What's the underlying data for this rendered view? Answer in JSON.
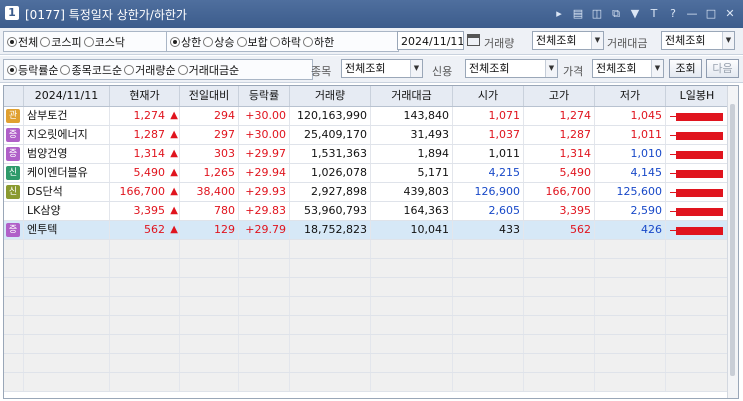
{
  "window": {
    "number": "1",
    "title": "[0177] 특정일자 상한가/하한가",
    "controls": [
      "▸",
      "▤",
      "◫",
      "⧉",
      "▼",
      "T",
      "?",
      "—",
      "□",
      "✕"
    ]
  },
  "filters1": {
    "market": [
      "전체",
      "코스피",
      "코스닥"
    ],
    "market_selected": "전체",
    "limit": [
      "상한",
      "상승",
      "보합",
      "하락",
      "하한"
    ],
    "limit_selected": "상한",
    "date": "2024/11/11",
    "volume_label": "거래량",
    "volume_value": "전체조회",
    "amount_label": "거래대금",
    "amount_value": "전체조회"
  },
  "filters2": {
    "sort": [
      "등락률순",
      "종목코드순",
      "거래량순",
      "거래대금순"
    ],
    "sort_selected": "등락률순",
    "item_label": "종목",
    "item_value": "전체조회",
    "credit_label": "신용",
    "credit_value": "전체조회",
    "price_label": "가격",
    "price_value": "전체조회",
    "search_btn": "조회",
    "next_btn": "다음"
  },
  "table": {
    "columns": [
      "2024/11/11",
      "현재가",
      "전일대비",
      "등락률",
      "거래량",
      "거래대금",
      "시가",
      "고가",
      "저가",
      "L일봉H"
    ],
    "rows": [
      {
        "badge": "관",
        "badge_color": "#e0a030",
        "name": "삼부토건",
        "price": "1,274",
        "change": "294",
        "rate": "+30.00",
        "volume": "120,163,990",
        "amount": "143,840",
        "open": "1,071",
        "open_dir": "up",
        "high": "1,274",
        "high_dir": "up",
        "low": "1,045",
        "low_dir": "up",
        "bar": 0.95
      },
      {
        "badge": "증",
        "badge_color": "#b060c8",
        "name": "지오릿에너지",
        "price": "1,287",
        "change": "297",
        "rate": "+30.00",
        "volume": "25,409,170",
        "amount": "31,493",
        "open": "1,037",
        "open_dir": "up",
        "high": "1,287",
        "high_dir": "up",
        "low": "1,011",
        "low_dir": "up",
        "bar": 0.95
      },
      {
        "badge": "증",
        "badge_color": "#b060c8",
        "name": "범양건영",
        "price": "1,314",
        "change": "303",
        "rate": "+29.97",
        "volume": "1,531,363",
        "amount": "1,894",
        "open": "1,011",
        "open_dir": "flat",
        "high": "1,314",
        "high_dir": "up",
        "low": "1,010",
        "low_dir": "dn",
        "bar": 0.95
      },
      {
        "badge": "신",
        "badge_color": "#2e9a6a",
        "name": "케이엔더블유",
        "price": "5,490",
        "change": "1,265",
        "rate": "+29.94",
        "volume": "1,026,078",
        "amount": "5,171",
        "open": "4,215",
        "open_dir": "dn",
        "high": "5,490",
        "high_dir": "up",
        "low": "4,145",
        "low_dir": "dn",
        "bar": 0.95
      },
      {
        "badge": "신",
        "badge_color": "#8a9a30",
        "name": "DS단석",
        "price": "166,700",
        "change": "38,400",
        "rate": "+29.93",
        "volume": "2,927,898",
        "amount": "439,803",
        "open": "126,900",
        "open_dir": "dn",
        "high": "166,700",
        "high_dir": "up",
        "low": "125,600",
        "low_dir": "dn",
        "bar": 0.95
      },
      {
        "badge": "",
        "badge_color": "",
        "name": "LK삼양",
        "price": "3,395",
        "change": "780",
        "rate": "+29.83",
        "volume": "53,960,793",
        "amount": "164,363",
        "open": "2,605",
        "open_dir": "dn",
        "high": "3,395",
        "high_dir": "up",
        "low": "2,590",
        "low_dir": "dn",
        "bar": 0.95
      },
      {
        "badge": "증",
        "badge_color": "#b060c8",
        "name": "엔투텍",
        "price": "562",
        "change": "129",
        "rate": "+29.79",
        "volume": "18,752,823",
        "amount": "10,041",
        "open": "433",
        "open_dir": "flat",
        "high": "562",
        "high_dir": "up",
        "low": "426",
        "low_dir": "dn",
        "bar": 0.95
      }
    ]
  }
}
